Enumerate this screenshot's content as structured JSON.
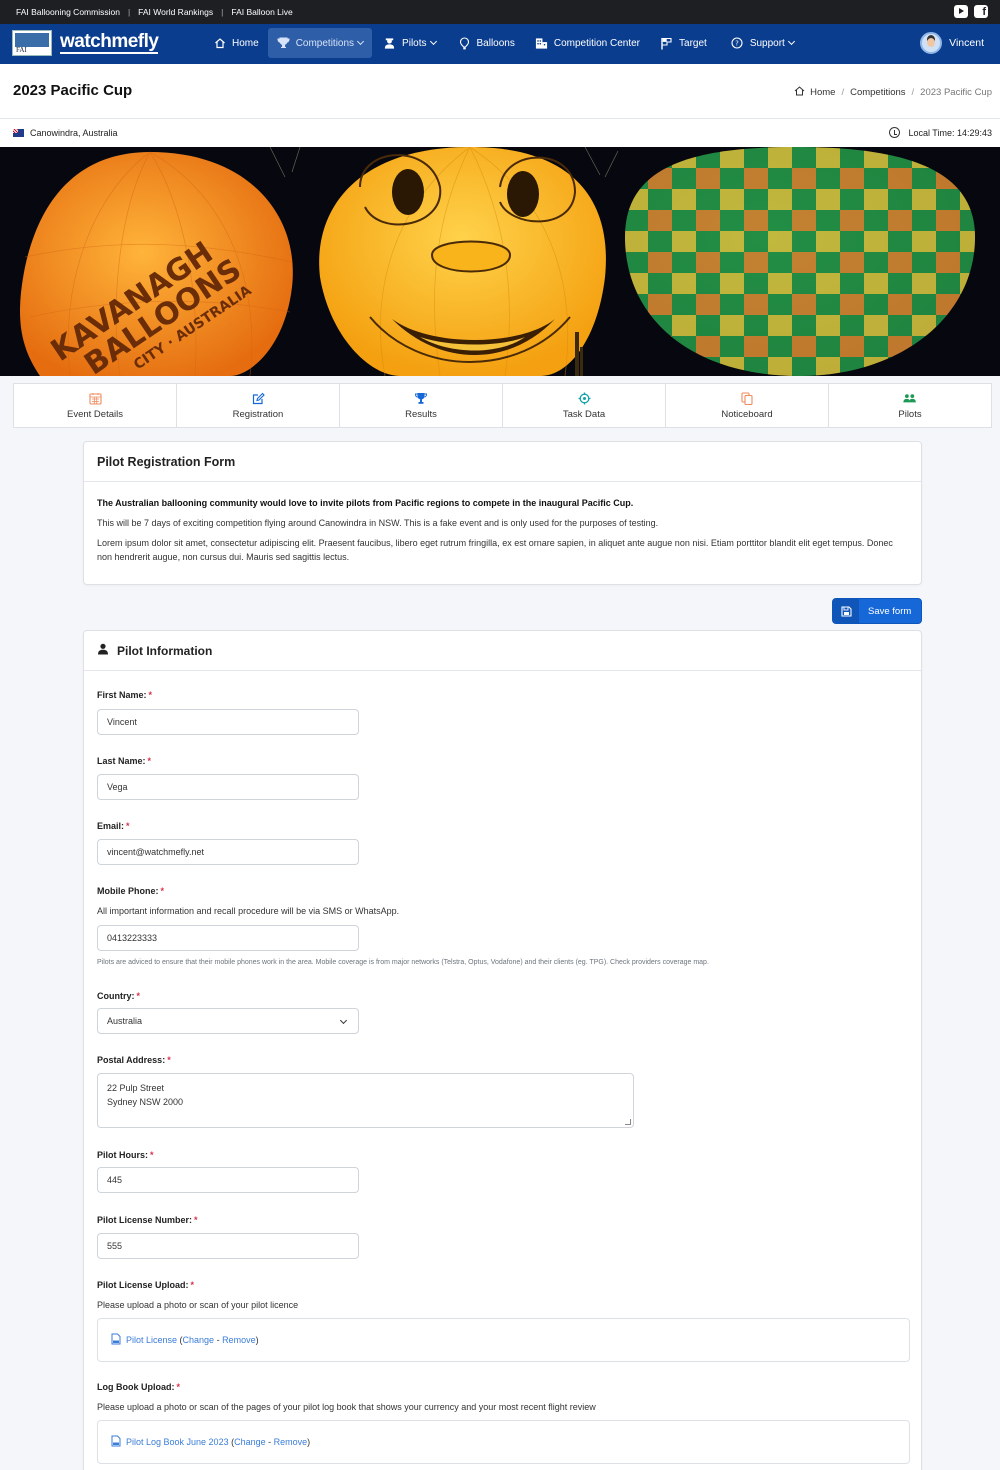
{
  "topbar": {
    "links": [
      "FAI Ballooning Commission",
      "FAI World Rankings",
      "FAI Balloon Live"
    ]
  },
  "nav": {
    "brand": "watchmefly",
    "logo_text": "FAI",
    "items": [
      {
        "label": "Home",
        "icon": "home-icon"
      },
      {
        "label": "Competitions",
        "icon": "trophy-icon",
        "dropdown": true,
        "active": true
      },
      {
        "label": "Pilots",
        "icon": "pilot-icon",
        "dropdown": true
      },
      {
        "label": "Balloons",
        "icon": "balloon-icon"
      },
      {
        "label": "Competition Center",
        "icon": "building-icon"
      },
      {
        "label": "Target",
        "icon": "target-flag-icon"
      },
      {
        "label": "Support",
        "icon": "help-circle-icon",
        "dropdown": true
      }
    ],
    "user_name": "Vincent",
    "brand_color": "#0b3d8f"
  },
  "page": {
    "title": "2023 Pacific Cup",
    "breadcrumb": [
      "Home",
      "Competitions",
      "2023 Pacific Cup"
    ],
    "location": "Canowindra, Australia",
    "local_time": "Local Time: 14:29:43"
  },
  "banner": {
    "balloon_text_line1": "KAVANAGH",
    "balloon_text_line2": "BALLOONS",
    "balloon_text_line3": "CITY · AUSTRALIA"
  },
  "tabs": [
    {
      "label": "Event Details",
      "icon": "calendar-icon",
      "color": "#f08a5d"
    },
    {
      "label": "Registration",
      "icon": "edit-icon",
      "color": "#1668d8"
    },
    {
      "label": "Results",
      "icon": "trophy-icon",
      "color": "#1668d8"
    },
    {
      "label": "Task Data",
      "icon": "crosshair-icon",
      "color": "#16a3a8"
    },
    {
      "label": "Noticeboard",
      "icon": "copy-icon",
      "color": "#f08a5d"
    },
    {
      "label": "Pilots",
      "icon": "users-icon",
      "color": "#1c9a55"
    }
  ],
  "intro": {
    "title": "Pilot Registration Form",
    "lead": "The Australian ballooning community would love to invite pilots from Pacific regions to compete in the inaugural Pacific Cup.",
    "p1": "This will be 7 days of exciting competition flying around Canowindra in NSW. This is a fake event and is only used for the purposes of testing.",
    "p2": "Lorem ipsum dolor sit amet, consectetur adipiscing elit. Praesent faucibus, libero eget rutrum fringilla, ex est ornare sapien, in aliquet ante augue non nisi. Etiam porttitor blandit elit eget tempus. Donec non hendrerit augue, non cursus dui. Mauris sed sagittis lectus."
  },
  "save_label": "Save form",
  "form": {
    "section_title": "Pilot Information",
    "first_name": {
      "label": "First Name:",
      "value": "Vincent"
    },
    "last_name": {
      "label": "Last Name:",
      "value": "Vega"
    },
    "email": {
      "label": "Email:",
      "value": "vincent@watchmefly.net"
    },
    "mobile": {
      "label": "Mobile Phone:",
      "help": "All important information and recall procedure will be via SMS or WhatsApp.",
      "value": "0413223333",
      "note": "Pilots are adviced to ensure that their mobile phones work in the area. Mobile coverage is from major networks (Telstra, Optus, Vodafone) and their clients (eg. TPG). Check providers coverage map."
    },
    "country": {
      "label": "Country:",
      "value": "Australia"
    },
    "postal": {
      "label": "Postal Address:",
      "line1": "22 Pulp Street",
      "line2": "Sydney NSW 2000"
    },
    "hours": {
      "label": "Pilot Hours:",
      "value": "445"
    },
    "license_number": {
      "label": "Pilot License Number:",
      "value": "555"
    },
    "license_upload": {
      "label": "Pilot License Upload:",
      "help": "Please upload a photo or scan of your pilot licence",
      "file": "Pilot License",
      "change": "Change",
      "remove": "Remove"
    },
    "logbook_upload": {
      "label": "Log Book Upload:",
      "help": "Please upload a photo or scan of the pages of your pilot log book that shows your currency and your most recent flight review",
      "file": "Pilot Log Book June 2023",
      "change": "Change",
      "remove": "Remove"
    }
  }
}
